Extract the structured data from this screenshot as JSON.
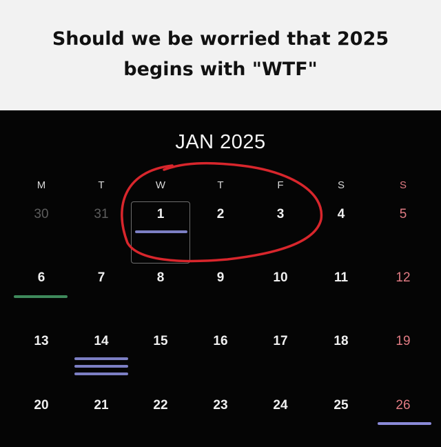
{
  "caption": {
    "line1": "Should we be worried that 2025",
    "line2": "begins with \"WTF\""
  },
  "calendar": {
    "month_label": "JAN 2025",
    "weekdays": [
      "M",
      "T",
      "W",
      "T",
      "F",
      "S",
      "S"
    ],
    "weeks": [
      [
        "30",
        "31",
        "1",
        "2",
        "3",
        "4",
        "5"
      ],
      [
        "6",
        "7",
        "8",
        "9",
        "10",
        "11",
        "12"
      ],
      [
        "13",
        "14",
        "15",
        "16",
        "17",
        "18",
        "19"
      ],
      [
        "20",
        "21",
        "22",
        "23",
        "24",
        "25",
        "26"
      ]
    ],
    "colors": {
      "background": "#050505",
      "sunday": "#e07b83",
      "muted": "#5d5d5d",
      "highlight_ring": "#d8262c",
      "event_blue": "#7c7fc4",
      "event_green": "#3f8a5c",
      "event_pink": "#8a8ad8"
    },
    "highlighted_weekdays": [
      "W",
      "T",
      "F"
    ],
    "selected_day": "1"
  }
}
